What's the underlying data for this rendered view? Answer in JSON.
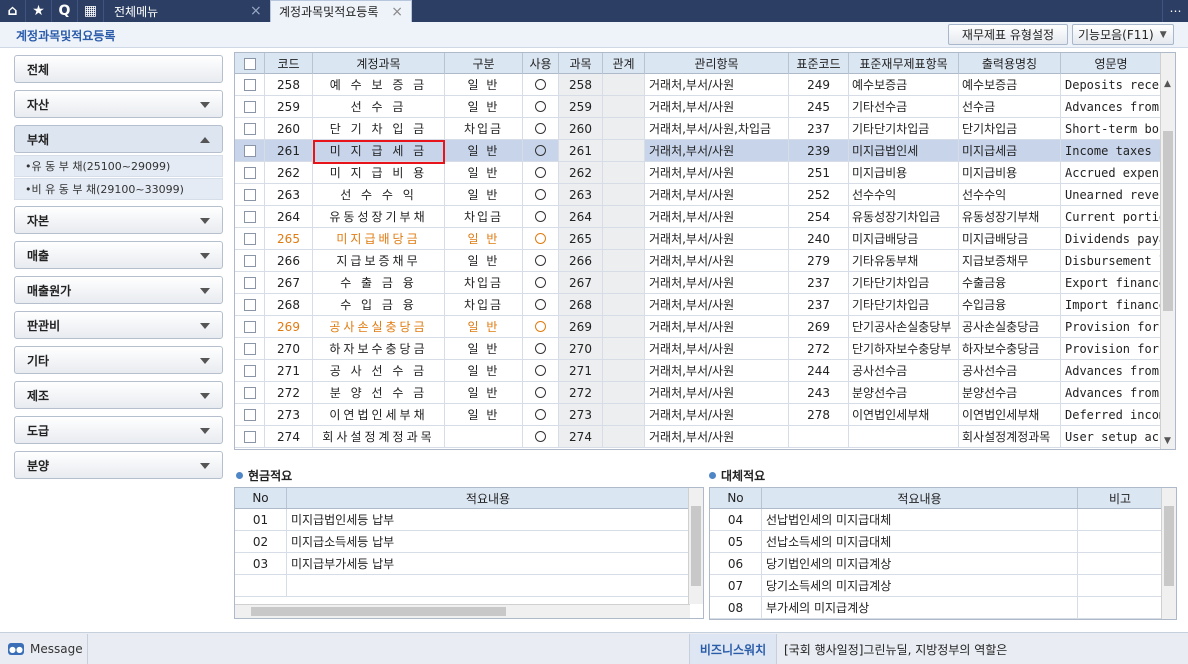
{
  "topbar": {
    "menu_label": "전체메뉴",
    "active_tab": "계정과목및적요등록",
    "home_icon": "⌂",
    "star_icon": "★",
    "search_icon": "Q",
    "grid_icon": "▦",
    "close_icon": "×",
    "more_icon": "⋯"
  },
  "header": {
    "title": "계정과목및적요등록",
    "btn_format": "재무제표 유형설정",
    "btn_functions": "기능모음(F11)"
  },
  "sidebar": {
    "items": [
      {
        "label": "전체"
      },
      {
        "label": "자산"
      },
      {
        "label": "부채"
      },
      {
        "label": "자본"
      },
      {
        "label": "매출"
      },
      {
        "label": "매출원가"
      },
      {
        "label": "판관비"
      },
      {
        "label": "기타"
      },
      {
        "label": "제조"
      },
      {
        "label": "도급"
      },
      {
        "label": "분양"
      }
    ],
    "sub_items": [
      {
        "label": "•유  동  부  채(25100~29099)"
      },
      {
        "label": "•비 유 동 부 채(29100~33099)"
      }
    ]
  },
  "grid": {
    "columns": [
      "코드",
      "계정과목",
      "구분",
      "사용",
      "과목",
      "관계",
      "관리항목",
      "표준코드",
      "표준재무제표항목",
      "출력용명칭",
      "영문명"
    ],
    "rows": [
      {
        "code": "258",
        "name": "예 수 보 증 금",
        "type": "일 반",
        "used": "○",
        "subj": "258",
        "rel": "",
        "mgmt": "거래처,부서/사원",
        "std": "249",
        "stditem": "예수보증금",
        "print": "예수보증금",
        "eng": "Deposits received"
      },
      {
        "code": "259",
        "name": "선   수   금",
        "type": "일 반",
        "used": "○",
        "subj": "259",
        "rel": "",
        "mgmt": "거래처,부서/사원",
        "std": "245",
        "stditem": "기타선수금",
        "print": "선수금",
        "eng": "Advances from customers"
      },
      {
        "code": "260",
        "name": "단 기 차 입 금",
        "type": "차입금",
        "used": "○",
        "subj": "260",
        "rel": "",
        "mgmt": "거래처,부서/사원,차입금",
        "std": "237",
        "stditem": "기타단기차입금",
        "print": "단기차입금",
        "eng": "Short-term borrowings"
      },
      {
        "code": "261",
        "name": "미 지 급 세 금",
        "type": "일 반",
        "used": "○",
        "subj": "261",
        "rel": "",
        "mgmt": "거래처,부서/사원",
        "std": "239",
        "stditem": "미지급법인세",
        "print": "미지급세금",
        "eng": "Income taxes payable"
      },
      {
        "code": "262",
        "name": "미 지 급 비 용",
        "type": "일 반",
        "used": "○",
        "subj": "262",
        "rel": "",
        "mgmt": "거래처,부서/사원",
        "std": "251",
        "stditem": "미지급비용",
        "print": "미지급비용",
        "eng": "Accrued expenses"
      },
      {
        "code": "263",
        "name": "선 수 수 익",
        "type": "일 반",
        "used": "○",
        "subj": "263",
        "rel": "",
        "mgmt": "거래처,부서/사원",
        "std": "252",
        "stditem": "선수수익",
        "print": "선수수익",
        "eng": "Unearned revenue"
      },
      {
        "code": "264",
        "name": "유동성장기부채",
        "type": "차입금",
        "used": "○",
        "subj": "264",
        "rel": "",
        "mgmt": "거래처,부서/사원",
        "std": "254",
        "stditem": "유동성장기차입금",
        "print": "유동성장기부채",
        "eng": "Current portion"
      },
      {
        "code": "265",
        "name": "미지급배당금",
        "type": "일 반",
        "used": "○",
        "subj": "265",
        "rel": "",
        "mgmt": "거래처,부서/사원",
        "std": "240",
        "stditem": "미지급배당금",
        "print": "미지급배당금",
        "eng": "Dividends payable",
        "orange": true
      },
      {
        "code": "266",
        "name": "지급보증채무",
        "type": "일 반",
        "used": "○",
        "subj": "266",
        "rel": "",
        "mgmt": "거래처,부서/사원",
        "std": "279",
        "stditem": "기타유동부채",
        "print": "지급보증채무",
        "eng": "Disbursement l"
      },
      {
        "code": "267",
        "name": "수 출 금 융",
        "type": "차입금",
        "used": "○",
        "subj": "267",
        "rel": "",
        "mgmt": "거래처,부서/사원",
        "std": "237",
        "stditem": "기타단기차입금",
        "print": "수출금융",
        "eng": "Export finance"
      },
      {
        "code": "268",
        "name": "수 입 금 융",
        "type": "차입금",
        "used": "○",
        "subj": "268",
        "rel": "",
        "mgmt": "거래처,부서/사원",
        "std": "237",
        "stditem": "기타단기차입금",
        "print": "수입금융",
        "eng": "Import finance"
      },
      {
        "code": "269",
        "name": "공사손실충당금",
        "type": "일 반",
        "used": "○",
        "subj": "269",
        "rel": "",
        "mgmt": "거래처,부서/사원",
        "std": "269",
        "stditem": "단기공사손실충당부",
        "print": "공사손실충당금",
        "eng": "Provision for c",
        "orange": true
      },
      {
        "code": "270",
        "name": "하자보수충당금",
        "type": "일 반",
        "used": "○",
        "subj": "270",
        "rel": "",
        "mgmt": "거래처,부서/사원",
        "std": "272",
        "stditem": "단기하자보수충당부",
        "print": "하자보수충당금",
        "eng": "Provision for c"
      },
      {
        "code": "271",
        "name": "공 사 선 수 금",
        "type": "일 반",
        "used": "○",
        "subj": "271",
        "rel": "",
        "mgmt": "거래처,부서/사원",
        "std": "244",
        "stditem": "공사선수금",
        "print": "공사선수금",
        "eng": "Advances from c"
      },
      {
        "code": "272",
        "name": "분 양 선 수 금",
        "type": "일 반",
        "used": "○",
        "subj": "272",
        "rel": "",
        "mgmt": "거래처,부서/사원",
        "std": "243",
        "stditem": "분양선수금",
        "print": "분양선수금",
        "eng": "Advances from r"
      },
      {
        "code": "273",
        "name": "이연법인세부채",
        "type": "일 반",
        "used": "○",
        "subj": "273",
        "rel": "",
        "mgmt": "거래처,부서/사원",
        "std": "278",
        "stditem": "이연법인세부채",
        "print": "이연법인세부채",
        "eng": "Deferred income"
      },
      {
        "code": "274",
        "name": "회사설정계정과목",
        "type": "",
        "used": "○",
        "subj": "274",
        "rel": "",
        "mgmt": "거래처,부서/사원",
        "std": "",
        "stditem": "",
        "print": "회사설정계정과목",
        "eng": "User setup account"
      }
    ]
  },
  "cash_summary": {
    "title": "현금적요",
    "col_no": "No",
    "col_content": "적요내용",
    "rows": [
      {
        "no": "01",
        "text": "미지급법인세등 납부"
      },
      {
        "no": "02",
        "text": "미지급소득세등 납부"
      },
      {
        "no": "03",
        "text": "미지급부가세등 납부"
      }
    ]
  },
  "transfer_summary": {
    "title": "대체적요",
    "col_no": "No",
    "col_content": "적요내용",
    "col_note": "비고",
    "rows": [
      {
        "no": "04",
        "text": "선납법인세의 미지급대체"
      },
      {
        "no": "05",
        "text": "선납소득세의 미지급대체"
      },
      {
        "no": "06",
        "text": "당기법인세의 미지급계상"
      },
      {
        "no": "07",
        "text": "당기소득세의 미지급계상"
      },
      {
        "no": "08",
        "text": "부가세의 미지급계상"
      }
    ]
  },
  "statusbar": {
    "message_label": "Message",
    "biz_label": "비즈니스워치",
    "news": "[국회 행사일정]그린뉴딜, 지방정부의 역할은"
  }
}
